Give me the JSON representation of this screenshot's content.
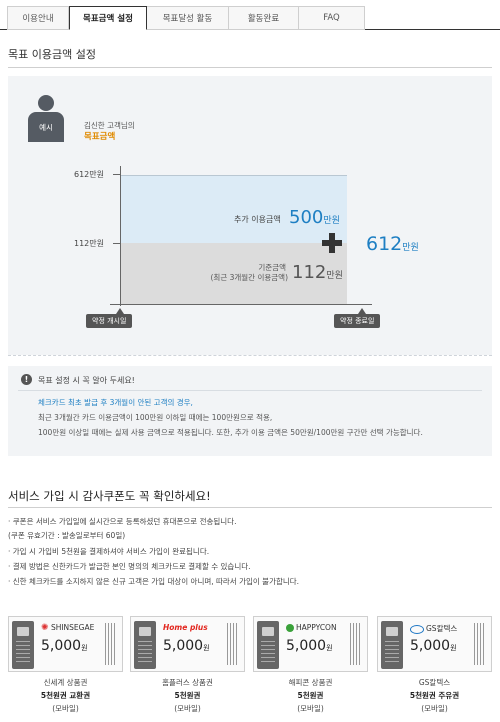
{
  "tabs": [
    "이용안내",
    "목표금액 설정",
    "목표달성 활동",
    "활동완료",
    "FAQ"
  ],
  "active_tab": 1,
  "section_title": "목표 이용금액 설정",
  "example": {
    "avatar_label": "예시",
    "customer_name": "김신한 고객님의",
    "goal_label": "목표금액"
  },
  "graph": {
    "top_tick": "612만원",
    "bottom_tick": "112만원",
    "added_label": "추가 이용금액",
    "added_value": "500",
    "added_unit": "만원",
    "base_label": "기준금액",
    "base_sub": "(최근 3개월간 이용금액)",
    "base_value": "112",
    "base_unit": "만원",
    "total_value": "612",
    "total_unit": "만원",
    "start_label": "약정 개시일",
    "end_label": "약정 종료일"
  },
  "notice": {
    "icon": "!",
    "title": "목표 설정 시 꼭 알아 두세요!",
    "line1": "체크카드 최초 발급 후 3개월이 안된 고객의 경우,",
    "line2": "최근 3개월간 카드 이용금액이 100만원 이하일 때에는 100만원으로 적용,",
    "line3": "100만원 이상일 때에는 실제 사용 금액으로 적용됩니다. 또한, 추가 이용 금액은 50만원/100만원 구간만 선택 가능합니다."
  },
  "coupon_section": {
    "title": "서비스 가입 시 감사쿠폰도 꼭 확인하세요!",
    "bullets": [
      "· 쿠폰은 서비스 가입일에 실시간으로 등록하셨던 휴대폰으로 전송됩니다.",
      "  (쿠폰 유효기간 : 발송일로부터 60일)",
      "· 가입 시 가입비 5천원을 결제하셔야 서비스 가입이 완료됩니다.",
      "· 결제 방법은 신한카드가 발급한 본인 명의의 체크카드로 결제할 수 있습니다.",
      "· 신한 체크카드를 소지하지 않은 신규 고객은 가입 대상이 아니며, 따라서 가입이 불가합니다."
    ],
    "coupons": [
      {
        "brand": "SHINSEGAE",
        "amount": "5,000",
        "unit": "원",
        "name": "신세계 상품권",
        "type": "5천원권 교환권",
        "channel": "(모바일)"
      },
      {
        "brand": "Home plus",
        "amount": "5,000",
        "unit": "원",
        "name": "홈플러스 상품권",
        "type": "5천원권",
        "channel": "(모바일)"
      },
      {
        "brand": "HAPPYCON",
        "amount": "5,000",
        "unit": "원",
        "name": "해피콘 상품권",
        "type": "5천원권",
        "channel": "(모바일)"
      },
      {
        "brand": "GS칼텍스",
        "amount": "5,000",
        "unit": "원",
        "name": "GS칼텍스",
        "type": "5천원권 주유권",
        "channel": "(모바일)"
      }
    ]
  },
  "colors": {
    "accent_blue": "#1e7fc3",
    "goal_orange": "#e08a00",
    "panel_bg": "#f2f4f6"
  }
}
